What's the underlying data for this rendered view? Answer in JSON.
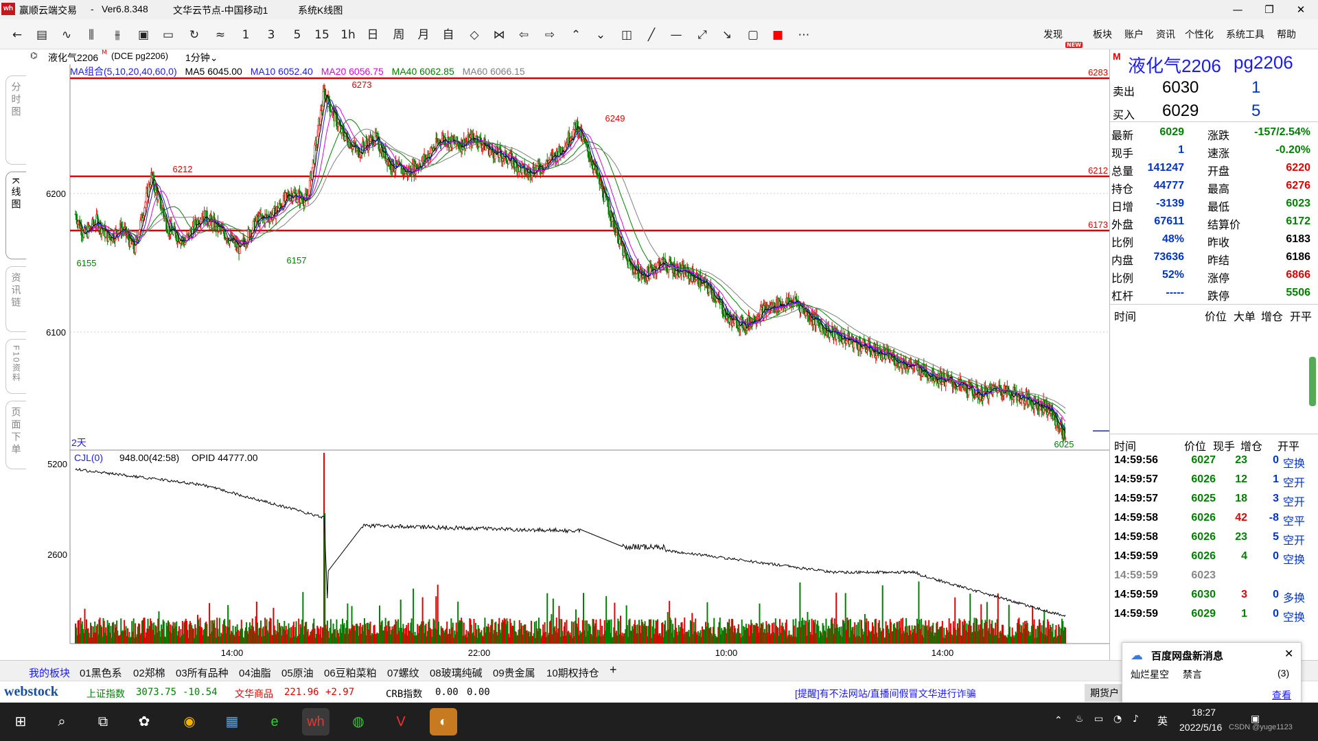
{
  "titlebar": {
    "app_name": "赢顺云端交易",
    "sep": "-",
    "version": "Ver6.8.348",
    "node": "文华云节点-中国移动1",
    "view": "系统K线图",
    "logo_text": "wh"
  },
  "toolbar": {
    "periods": [
      "1",
      "3",
      "5",
      "15",
      "1h",
      "日",
      "周",
      "月",
      "自"
    ],
    "menus": [
      "发现",
      "板块",
      "账户",
      "资讯",
      "个性化",
      "系统工具",
      "帮助"
    ],
    "new_badge": "NEW"
  },
  "left_tabs": [
    "分时图",
    "K线图",
    "资讯链",
    "F10资料",
    "页面下单"
  ],
  "chart": {
    "symbol": "液化气2206",
    "symbol_mark": "M",
    "code": "(DCE pg2206)",
    "period": "1分钟",
    "ma_labels": [
      {
        "text": "MA组合(5,10,20,40,60,0)",
        "color": "#1a1aff"
      },
      {
        "text": "MA5 6045.00",
        "color": "#000000"
      },
      {
        "text": "MA10 6052.40",
        "color": "#1a1aff"
      },
      {
        "text": "MA20 6056.75",
        "color": "#e000e0"
      },
      {
        "text": "MA40 6062.85",
        "color": "#008000"
      },
      {
        "text": "MA60 6066.15",
        "color": "#808080"
      }
    ],
    "price_ticks": [
      "6200",
      "6100"
    ],
    "hlines": [
      "6283",
      "6212",
      "6173"
    ],
    "annotations": [
      "6273",
      "6249",
      "6212",
      "6155",
      "6157",
      "6025"
    ],
    "days_label": "2天",
    "time_labels": [
      "14:00",
      "22:00",
      "10:00",
      "14:00"
    ],
    "vol_header": "CJL(0)",
    "vol_value": "948.00(42:58)",
    "opid": "OPID 44777.00",
    "vol_ticks": [
      "5200",
      "2600"
    ]
  },
  "chart_data": {
    "type": "candlestick",
    "title": "液化气2206 (DCE pg2206) 1分钟",
    "ylim": [
      6020,
      6290
    ],
    "key_prices": {
      "high": 6273,
      "second_high": 6249,
      "low_left": 6155,
      "low_mid": 6157,
      "last": 6025
    },
    "horizontal_lines": [
      6283,
      6212,
      6173
    ],
    "path_points": [
      [
        0,
        6185
      ],
      [
        10,
        6170
      ],
      [
        25,
        6180
      ],
      [
        40,
        6168
      ],
      [
        55,
        6175
      ],
      [
        70,
        6160
      ],
      [
        90,
        6212
      ],
      [
        110,
        6175
      ],
      [
        130,
        6165
      ],
      [
        150,
        6185
      ],
      [
        175,
        6172
      ],
      [
        195,
        6160
      ],
      [
        215,
        6180
      ],
      [
        235,
        6185
      ],
      [
        255,
        6200
      ],
      [
        275,
        6195
      ],
      [
        295,
        6273
      ],
      [
        315,
        6245
      ],
      [
        335,
        6230
      ],
      [
        355,
        6240
      ],
      [
        375,
        6220
      ],
      [
        395,
        6215
      ],
      [
        415,
        6225
      ],
      [
        435,
        6240
      ],
      [
        455,
        6235
      ],
      [
        475,
        6240
      ],
      [
        495,
        6230
      ],
      [
        515,
        6225
      ],
      [
        535,
        6215
      ],
      [
        555,
        6220
      ],
      [
        575,
        6230
      ],
      [
        595,
        6249
      ],
      [
        615,
        6220
      ],
      [
        635,
        6185
      ],
      [
        655,
        6150
      ],
      [
        675,
        6140
      ],
      [
        695,
        6150
      ],
      [
        715,
        6145
      ],
      [
        735,
        6140
      ],
      [
        755,
        6130
      ],
      [
        775,
        6110
      ],
      [
        795,
        6105
      ],
      [
        815,
        6115
      ],
      [
        835,
        6120
      ],
      [
        855,
        6122
      ],
      [
        875,
        6110
      ],
      [
        895,
        6100
      ],
      [
        915,
        6095
      ],
      [
        935,
        6090
      ],
      [
        955,
        6085
      ],
      [
        975,
        6080
      ],
      [
        995,
        6075
      ],
      [
        1015,
        6070
      ],
      [
        1035,
        6065
      ],
      [
        1055,
        6060
      ],
      [
        1075,
        6055
      ],
      [
        1095,
        6060
      ],
      [
        1115,
        6055
      ],
      [
        1135,
        6050
      ],
      [
        1155,
        6045
      ],
      [
        1175,
        6025
      ]
    ],
    "volume_ticks": [
      5200,
      2600
    ]
  },
  "quote": {
    "title": "液化气2206",
    "code": "pg2206",
    "mark": "M",
    "ask_label": "卖出",
    "ask_price": "6030",
    "ask_qty": "1",
    "bid_label": "买入",
    "bid_price": "6029",
    "bid_qty": "5",
    "left": [
      {
        "k": "最新",
        "v": "6029",
        "c": "green"
      },
      {
        "k": "现手",
        "v": "1",
        "c": "blue"
      },
      {
        "k": "总量",
        "v": "141247",
        "c": "blue"
      },
      {
        "k": "持仓",
        "v": "44777",
        "c": "blue"
      },
      {
        "k": "日增",
        "v": "-3139",
        "c": "blue"
      },
      {
        "k": "外盘",
        "v": "67611",
        "c": "blue"
      },
      {
        "k": "比例",
        "v": "48%",
        "c": "blue"
      },
      {
        "k": "内盘",
        "v": "73636",
        "c": "blue"
      },
      {
        "k": "比例",
        "v": "52%",
        "c": "blue"
      },
      {
        "k": "杠杆",
        "v": "-----",
        "c": "blue"
      }
    ],
    "right": [
      {
        "k": "涨跌",
        "v": "-157/2.54%",
        "c": "green"
      },
      {
        "k": "速涨",
        "v": "-0.20%",
        "c": "green"
      },
      {
        "k": "开盘",
        "v": "6220",
        "c": "red"
      },
      {
        "k": "最高",
        "v": "6276",
        "c": "red"
      },
      {
        "k": "最低",
        "v": "6023",
        "c": "green"
      },
      {
        "k": "结算价",
        "v": "6172",
        "c": "green"
      },
      {
        "k": "昨收",
        "v": "6183",
        "c": "black"
      },
      {
        "k": "昨结",
        "v": "6186",
        "c": "black"
      },
      {
        "k": "涨停",
        "v": "6866",
        "c": "red"
      },
      {
        "k": "跌停",
        "v": "5506",
        "c": "green"
      }
    ],
    "header1": [
      "时间",
      "价位",
      "大单",
      "增仓",
      "开平"
    ],
    "header2": [
      "时间",
      "价位",
      "现手",
      "增仓",
      "开平"
    ],
    "ticks": [
      {
        "t": "14:59:56",
        "p": "6027",
        "q": "23",
        "d": "0",
        "o": "空换",
        "qc": "green",
        "pc": "green"
      },
      {
        "t": "14:59:57",
        "p": "6026",
        "q": "12",
        "d": "1",
        "o": "空开",
        "qc": "green",
        "pc": "green"
      },
      {
        "t": "14:59:57",
        "p": "6025",
        "q": "18",
        "d": "3",
        "o": "空开",
        "qc": "green",
        "pc": "green"
      },
      {
        "t": "14:59:58",
        "p": "6026",
        "q": "42",
        "d": "-8",
        "o": "空平",
        "qc": "red",
        "pc": "green"
      },
      {
        "t": "14:59:58",
        "p": "6026",
        "q": "23",
        "d": "5",
        "o": "空开",
        "qc": "green",
        "pc": "green"
      },
      {
        "t": "14:59:59",
        "p": "6026",
        "q": "4",
        "d": "0",
        "o": "空换",
        "qc": "green",
        "pc": "green"
      },
      {
        "t": "14:59:59",
        "p": "6023",
        "q": "",
        "d": "",
        "o": "",
        "qc": "gray",
        "pc": "gray"
      },
      {
        "t": "14:59:59",
        "p": "6030",
        "q": "3",
        "d": "0",
        "o": "多换",
        "qc": "red",
        "pc": "green"
      },
      {
        "t": "14:59:59",
        "p": "6029",
        "q": "1",
        "d": "0",
        "o": "空换",
        "qc": "green",
        "pc": "green"
      }
    ]
  },
  "tabs": [
    "我的板块",
    "01黑色系",
    "02郑棉",
    "03所有品种",
    "04油脂",
    "05原油",
    "06豆粕菜粕",
    "07螺纹",
    "08玻璃纯碱",
    "09贵金属",
    "10期权持仓",
    "+"
  ],
  "status": {
    "brand": "webstock",
    "idx1_name": "上证指数",
    "idx1_val": "3073.75",
    "idx1_chg": "-10.54",
    "idx2_name": "文华商品",
    "idx2_val": "221.96",
    "idx2_chg": "+2.97",
    "idx3_name": "CRB指数",
    "idx3_val": "0.00",
    "idx3_chg": "0.00",
    "notice": "[提醒]有不法网站/直播间假冒文华进行诈骗",
    "right_btn": "期货户"
  },
  "notify": {
    "title": "百度网盘新消息",
    "item": "灿烂星空",
    "sub": "禁言",
    "count": "(3)",
    "link": "查看",
    "close": "✕"
  },
  "taskbar": {
    "time": "18:27",
    "date": "2022/5/16",
    "ime": "英",
    "watermark": "CSDN @yuge1123"
  }
}
